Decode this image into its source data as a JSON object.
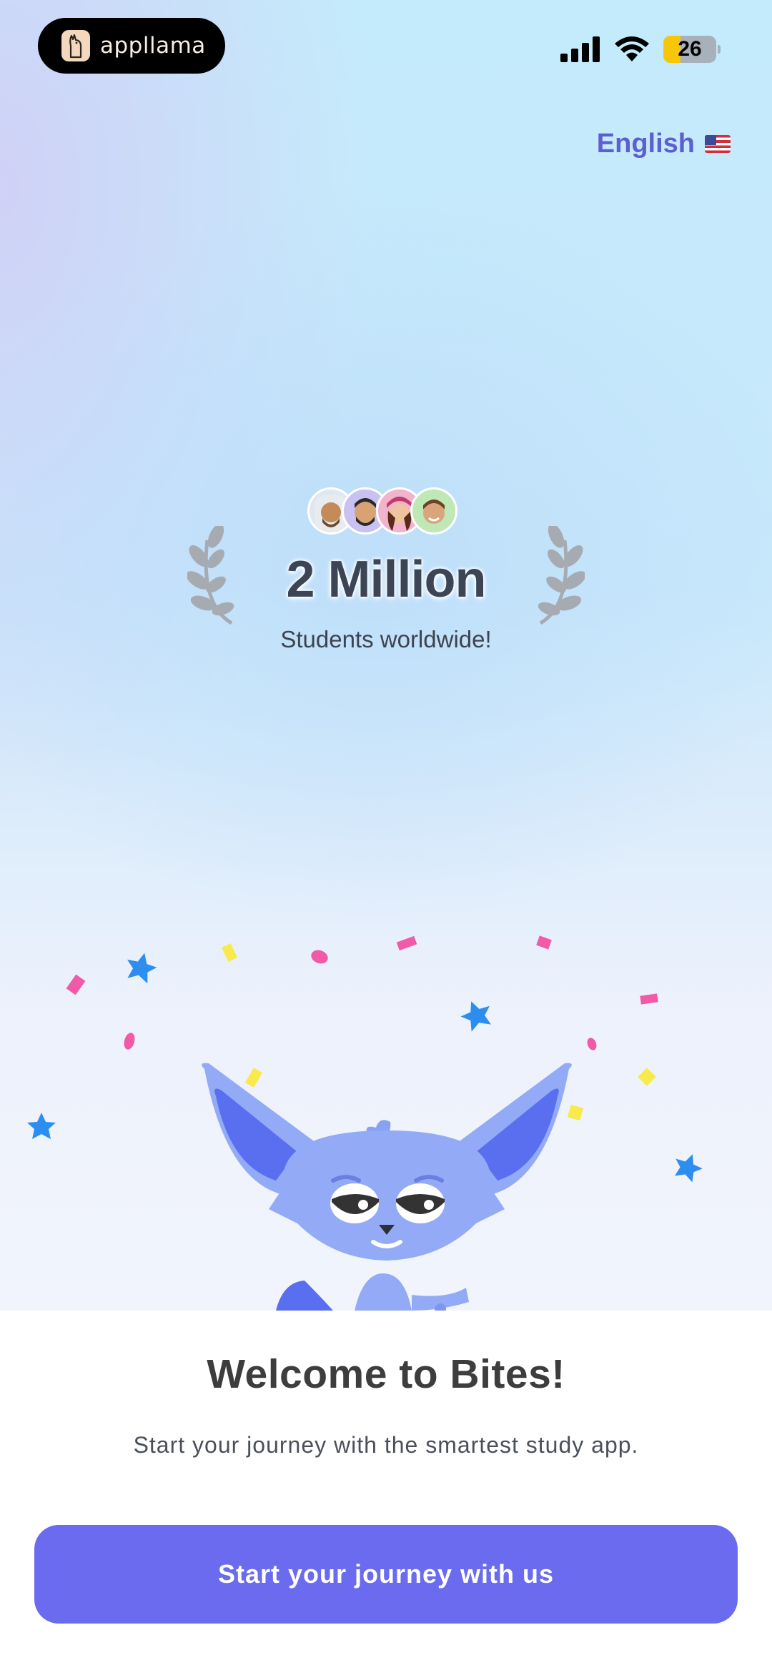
{
  "status_bar": {
    "badge_app_name": "appllama",
    "battery_level": "26"
  },
  "language": {
    "label": "English",
    "flag": "us-flag-icon"
  },
  "social_proof": {
    "count": "2 Million",
    "subtitle": "Students worldwide!",
    "avatars": [
      "avatar-man-headscarf",
      "avatar-man-beard",
      "avatar-woman-cap",
      "avatar-man-smile"
    ]
  },
  "welcome": {
    "title": "Welcome to Bites!",
    "subtitle": "Start your journey with the smartest study app."
  },
  "cta": {
    "label": "Start your journey with us"
  },
  "colors": {
    "accent": "#6b6bef",
    "language_text": "#5c5fd2",
    "mascot": "#93abf6"
  }
}
